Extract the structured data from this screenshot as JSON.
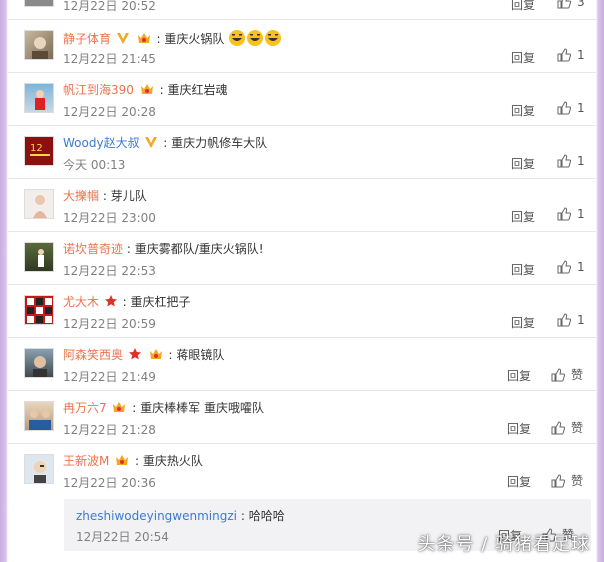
{
  "labels": {
    "reply": "回复",
    "like_word": "赞"
  },
  "top_row": {
    "time": "12月22日 20:52",
    "reply": "回复",
    "likes": "3"
  },
  "comments": [
    {
      "user": "静子体育",
      "text": "重庆火锅队",
      "time": "12月22日 21:45",
      "likes": "1"
    },
    {
      "user": "帆江到海390",
      "text": "重庆红岩魂",
      "time": "12月22日 20:28",
      "likes": "1"
    },
    {
      "user": "Woody赵大叔",
      "text": "重庆力帆修车大队",
      "time": "今天 00:13",
      "likes": "1"
    },
    {
      "user": "大擽帼",
      "text": "芽儿队",
      "time": "12月22日 23:00",
      "likes": "1"
    },
    {
      "user": "诺坎普奇迹",
      "text": "重庆雾都队/重庆火锅队!",
      "time": "12月22日 22:53",
      "likes": "1"
    },
    {
      "user": "尤大木",
      "text": "重庆杠把子",
      "time": "12月22日 20:59",
      "likes": "1"
    },
    {
      "user": "阿森笑西奥",
      "text": "蒋眼镜队",
      "time": "12月22日 21:49",
      "likes": "赞"
    },
    {
      "user": "冉万六7",
      "text": "重庆棒棒军 重庆哦嚯队",
      "time": "12月22日 21:28",
      "likes": "赞"
    },
    {
      "user": "王新波M",
      "text": "重庆热火队",
      "time": "12月22日 20:36",
      "likes": "赞"
    }
  ],
  "sub_reply": {
    "user": "zheshiwodeyingwenmingzi",
    "text": "哈哈哈",
    "time": "12月22日 20:54",
    "reply": "回复",
    "likes": "赞"
  },
  "watermark": "头条号 / 骑猪看足球",
  "colors": {
    "username": "#eb7350",
    "link_blue": "#3a7bd5",
    "time": "#808080",
    "divider": "#e6e6e6",
    "bg_side": "#c8aee0"
  }
}
